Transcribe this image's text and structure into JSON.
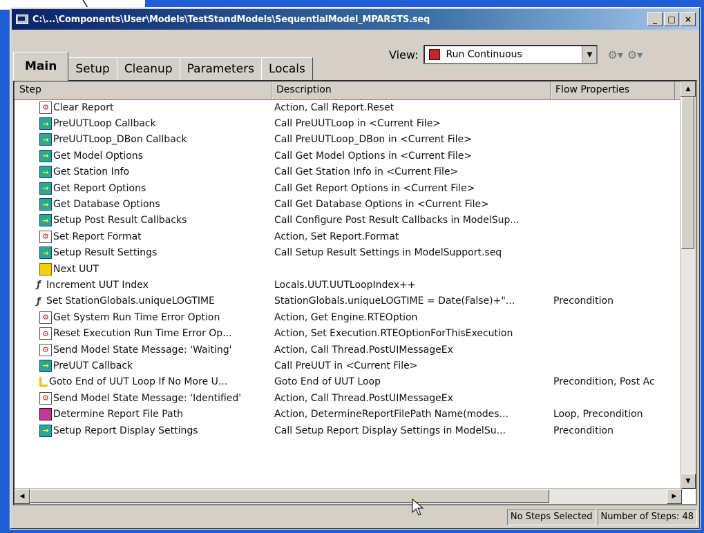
{
  "window": {
    "title": "C:\\...\\Components\\User\\Models\\TestStandModels\\SequentialModel_MPARSTS.seq",
    "controls": [
      "_",
      "□",
      "×"
    ]
  },
  "tabs": [
    {
      "label": "Main",
      "active": true
    },
    {
      "label": "Setup",
      "active": false
    },
    {
      "label": "Cleanup",
      "active": false
    },
    {
      "label": "Parameters",
      "active": false
    },
    {
      "label": "Locals",
      "active": false
    }
  ],
  "view": {
    "label": "View:",
    "selected": "Run Continuous"
  },
  "columns": {
    "step": "Step",
    "description": "Description",
    "flow": "Flow Properties"
  },
  "steps": [
    {
      "icon": "action",
      "indent": 1,
      "name": "Clear Report",
      "description": "Action, Call Report.Reset",
      "flow": ""
    },
    {
      "icon": "call",
      "indent": 1,
      "name": "PreUUTLoop Callback",
      "description": "Call PreUUTLoop in <Current File>",
      "flow": ""
    },
    {
      "icon": "call",
      "indent": 1,
      "name": "PreUUTLoop_DBon Callback",
      "description": "Call PreUUTLoop_DBon in <Current File>",
      "flow": ""
    },
    {
      "icon": "call",
      "indent": 1,
      "name": "Get Model Options",
      "description": "Call Get Model Options in <Current File>",
      "flow": ""
    },
    {
      "icon": "call",
      "indent": 1,
      "name": "Get Station Info",
      "description": "Call Get Station Info in <Current File>",
      "flow": ""
    },
    {
      "icon": "call",
      "indent": 1,
      "name": "Get Report Options",
      "description": "Call Get Report Options in <Current File>",
      "flow": ""
    },
    {
      "icon": "call",
      "indent": 1,
      "name": "Get Database Options",
      "description": "Call Get Database Options in <Current File>",
      "flow": ""
    },
    {
      "icon": "call",
      "indent": 1,
      "name": "Setup Post Result Callbacks",
      "description": "Call Configure Post Result Callbacks in ModelSup...",
      "flow": ""
    },
    {
      "icon": "action",
      "indent": 1,
      "name": "Set Report Format",
      "description": "Action, Set Report.Format",
      "flow": ""
    },
    {
      "icon": "call",
      "indent": 1,
      "name": "Setup Result Settings",
      "description": "Call Setup Result Settings in ModelSupport.seq",
      "flow": ""
    },
    {
      "icon": "label",
      "indent": 1,
      "name": "Next UUT",
      "description": "",
      "flow": ""
    },
    {
      "icon": "stmt",
      "indent": 0,
      "name": "Increment UUT Index",
      "description": "Locals.UUT.UUTLoopIndex++",
      "flow": ""
    },
    {
      "icon": "stmt",
      "indent": 0,
      "name": "Set StationGlobals.uniqueLOGTIME",
      "description": "StationGlobals.uniqueLOGTIME = Date(False)+\"...",
      "flow": "Precondition"
    },
    {
      "icon": "action",
      "indent": 1,
      "name": "Get System Run Time Error Option",
      "description": "Action, Get Engine.RTEOption",
      "flow": ""
    },
    {
      "icon": "action",
      "indent": 1,
      "name": "Reset Execution Run Time Error Op...",
      "description": "Action, Set Execution.RTEOptionForThisExecution",
      "flow": ""
    },
    {
      "icon": "action",
      "indent": 1,
      "name": "Send Model State Message: 'Waiting'",
      "description": "Action, Call Thread.PostUIMessageEx",
      "flow": ""
    },
    {
      "icon": "call",
      "indent": 1,
      "name": "PreUUT Callback",
      "description": "Call PreUUT in <Current File>",
      "flow": ""
    },
    {
      "icon": "goto",
      "indent": 1,
      "name": "Goto End of UUT Loop If No More U...",
      "description": "Goto End of UUT Loop",
      "flow": "Precondition, Post Ac"
    },
    {
      "icon": "action",
      "indent": 1,
      "name": "Send Model State Message: 'Identified'",
      "description": "Action, Call Thread.PostUIMessageEx",
      "flow": ""
    },
    {
      "icon": "pre",
      "indent": 1,
      "name": "Determine Report File Path",
      "description": "Action, DetermineReportFilePath Name(modes...",
      "flow": "Loop, Precondition"
    },
    {
      "icon": "call",
      "indent": 1,
      "name": "Setup Report Display Settings",
      "description": "Call Setup Report Display Settings in ModelSu...",
      "flow": "Precondition"
    }
  ],
  "status": {
    "selection": "No Steps Selected",
    "count": "Number of Steps: 48"
  },
  "colors": {
    "desktop": "#1f5fd6",
    "titlebar": "#0a246a",
    "face": "#d4d0c8"
  }
}
